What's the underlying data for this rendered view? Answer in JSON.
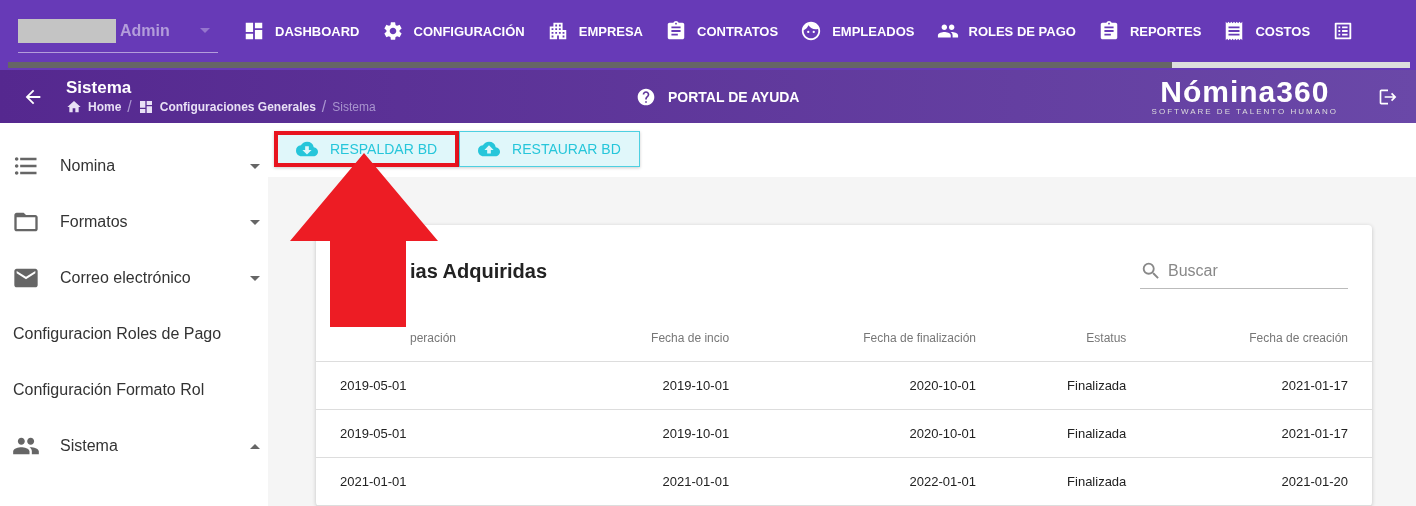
{
  "topbar": {
    "user": {
      "label": "Admin"
    },
    "nav": [
      {
        "label": "DASHBOARD"
      },
      {
        "label": "CONFIGURACIÓN"
      },
      {
        "label": "EMPRESA"
      },
      {
        "label": "CONTRATOS"
      },
      {
        "label": "EMPLEADOS"
      },
      {
        "label": "ROLES DE PAGO"
      },
      {
        "label": "REPORTES"
      },
      {
        "label": "COSTOS"
      }
    ],
    "progress": {
      "level": 0.83
    }
  },
  "subheader": {
    "title": "Sistema",
    "breadcrumb": [
      {
        "label": "Home",
        "current": false
      },
      {
        "label": "Configuraciones Generales",
        "current": false
      },
      {
        "label": "Sistema",
        "current": true
      }
    ],
    "separators": [
      "/",
      "/"
    ],
    "help": "PORTAL DE AYUDA",
    "logo": {
      "name": "Nómina360",
      "tagline": "SOFTWARE DE TALENTO HUMANO"
    }
  },
  "sidebar": {
    "items": [
      {
        "label": "Nomina",
        "expanded": false,
        "kind": "group"
      },
      {
        "label": "Formatos",
        "expanded": false,
        "kind": "group"
      },
      {
        "label": "Correo electrónico",
        "expanded": false,
        "kind": "group"
      },
      {
        "label": "Configuracion Roles de Pago",
        "kind": "link"
      },
      {
        "label": "Configuración Formato Rol",
        "kind": "link"
      },
      {
        "label": "Sistema",
        "expanded": true,
        "kind": "group"
      }
    ]
  },
  "actions": [
    {
      "label": "RESPALDAR BD",
      "highlighted": true
    },
    {
      "label": "RESTAURAR BD",
      "highlighted": false
    }
  ],
  "annotation": {
    "kind": "arrow"
  },
  "card": {
    "title": "ias Adquiridas",
    "search": {
      "placeholder": "Buscar"
    },
    "table": {
      "columns": [
        "peración",
        "Fecha de incio",
        "Fecha de finalización",
        "Estatus",
        "Fecha de creación"
      ],
      "rows": [
        [
          "2019-05-01",
          "2019-10-01",
          "2020-10-01",
          "Finalizada",
          "2021-01-17"
        ],
        [
          "2019-05-01",
          "2019-10-01",
          "2020-10-01",
          "Finalizada",
          "2021-01-17"
        ],
        [
          "2021-01-01",
          "2021-01-01",
          "2022-01-01",
          "Finalizada",
          "2021-01-20"
        ]
      ]
    }
  }
}
